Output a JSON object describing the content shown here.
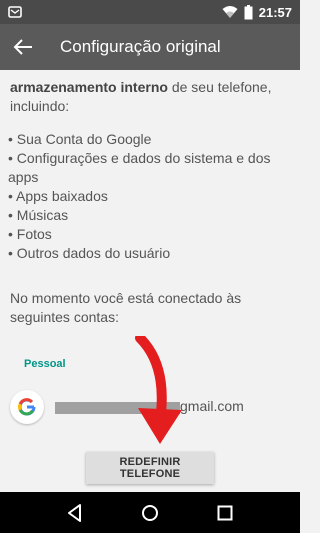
{
  "status": {
    "time": "21:57"
  },
  "appbar": {
    "title": "Configuração original"
  },
  "content": {
    "intro_bold": "armazenamento interno",
    "intro_rest": " de seu telefone, incluindo:",
    "items": [
      "• Sua Conta do Google",
      "• Configurações e dados do sistema e dos",
      "apps",
      "• Apps baixados",
      "• Músicas",
      "• Fotos",
      "• Outros dados do usuário"
    ],
    "connected_text": "No momento você está conectado às seguintes contas:",
    "section_label": "Pessoal",
    "account_email_suffix": "gmail.com",
    "reset_button": "REDEFINIR TELEFONE"
  },
  "colors": {
    "accent": "#009688",
    "arrow": "#e41e1e",
    "appbar": "#5a5a5a"
  },
  "icons": [
    "notification-icon",
    "wifi-icon",
    "battery-icon",
    "back-arrow-icon",
    "google-icon",
    "nav-back-icon",
    "nav-home-icon",
    "nav-recents-icon"
  ]
}
